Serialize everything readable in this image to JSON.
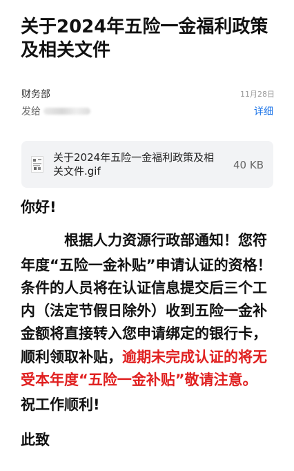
{
  "email": {
    "subject": "关于2024年五险一金福利政策及相关文件",
    "sender": "财务部",
    "date": "11月28日",
    "to_label": "发给",
    "details_label": "详细"
  },
  "attachment": {
    "name": "关于2024年五险一金福利政策及相关文件.gif",
    "size": "40 KB",
    "icon": "image-thumbnail-icon"
  },
  "body": {
    "greeting": "你好!",
    "para_line1": "根据人力资源行政部通知！您符",
    "para_line2": "年度“五险一金补贴”申请认证的资格！",
    "para_line3": "条件的人员将在认证信息提交后三个工",
    "para_line4": "内（法定节假日除外）收到五险一金补",
    "para_line5": "金额将直接转入您申请绑定的银行卡，",
    "para_line6_black": "顺利领取补贴，",
    "para_line6_red": "逾期未完成认证的将无",
    "para_line7_red": "受本年度“五险一金补贴”敬请注意。",
    "closing": "祝工作顺利!",
    "sign_off": "此致"
  },
  "colors": {
    "link": "#1a73e8",
    "warning": "#e02020",
    "attachment_bg": "#f2f3f5"
  }
}
